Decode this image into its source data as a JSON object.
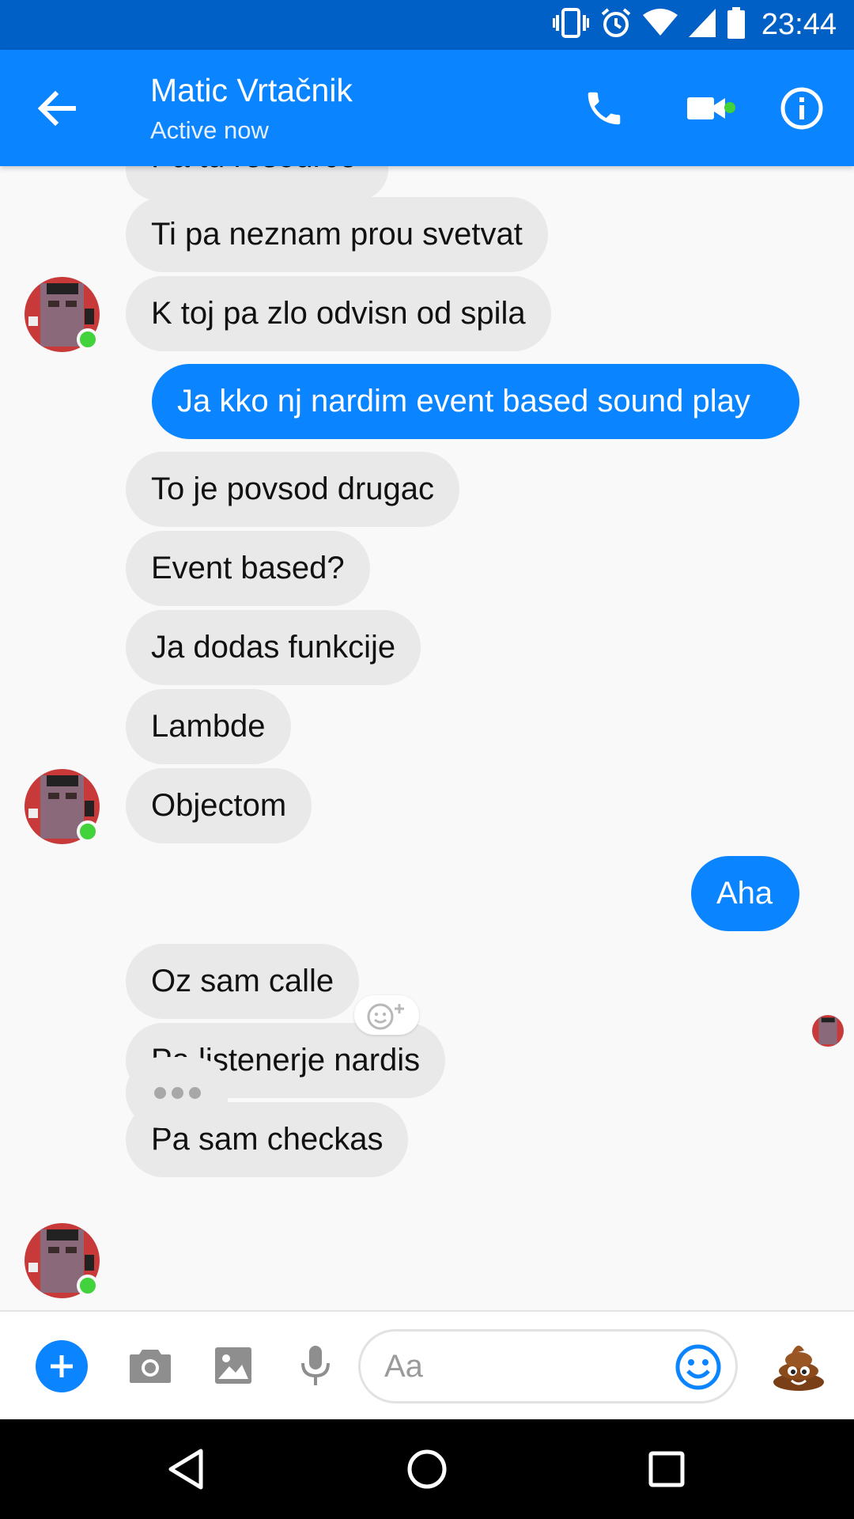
{
  "status_bar": {
    "time": "23:44",
    "icons": [
      "vibrate-icon",
      "alarm-icon",
      "wifi-icon",
      "signal-icon",
      "battery-icon"
    ]
  },
  "header": {
    "contact_name": "Matic Vrtačnik",
    "status": "Active now",
    "icons": [
      "back-arrow-icon",
      "phone-icon",
      "video-camera-icon",
      "info-icon"
    ],
    "accent_color": "#0b84ff"
  },
  "messages": [
    {
      "from": "them",
      "text": "Pa tu resource",
      "partial": true
    },
    {
      "from": "them",
      "text": "Ti pa neznam prou svetvat"
    },
    {
      "from": "them",
      "text": "K toj pa zlo odvisn od spila"
    },
    {
      "from": "me",
      "text": "Ja kko nj nardim event based sound play"
    },
    {
      "from": "them",
      "text": "To je povsod drugac"
    },
    {
      "from": "them",
      "text": "Event based?"
    },
    {
      "from": "them",
      "text": "Ja dodas funkcije"
    },
    {
      "from": "them",
      "text": "Lambde"
    },
    {
      "from": "them",
      "text": "Objectom"
    },
    {
      "from": "me",
      "text": "Aha"
    },
    {
      "from": "them",
      "text": "Oz sam calle"
    },
    {
      "from": "them",
      "text": "Pa listenerje nardis"
    },
    {
      "from": "them",
      "text": "Pa sam checkas"
    }
  ],
  "typing_indicator": true,
  "composer": {
    "placeholder": "Aa",
    "icons": [
      "plus-icon",
      "camera-icon",
      "image-icon",
      "microphone-icon",
      "smiley-icon",
      "poop-emoji-icon"
    ]
  },
  "nav_bar": {
    "icons": [
      "nav-back-icon",
      "nav-home-icon",
      "nav-recents-icon"
    ]
  },
  "colors": {
    "outgoing_bubble": "#0b84ff",
    "incoming_bubble": "#e9e9e9",
    "online_dot": "#42d23c",
    "status_bar": "#0060c6"
  }
}
